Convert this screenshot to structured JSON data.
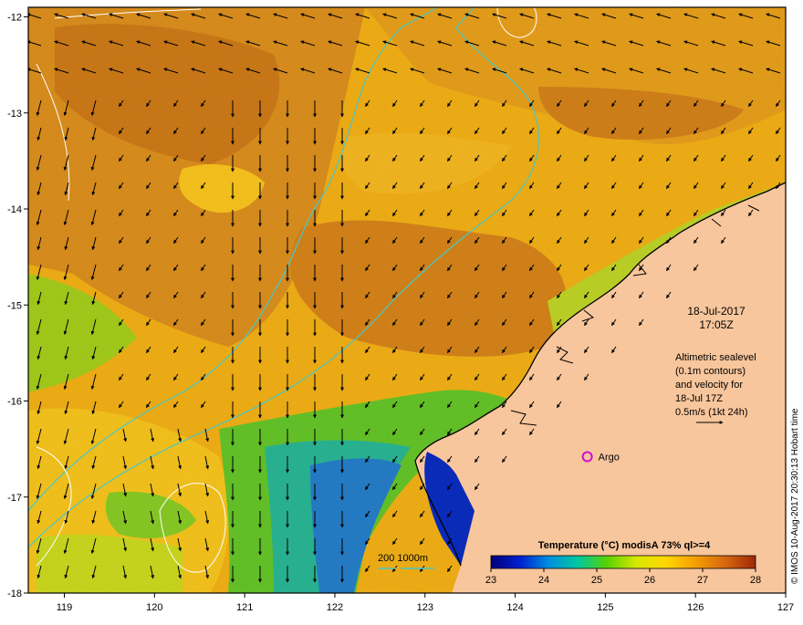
{
  "map": {
    "lon_ticks": [
      "119",
      "120",
      "121",
      "122",
      "123",
      "124",
      "125",
      "126",
      "127"
    ],
    "lat_ticks": [
      "-12",
      "-13",
      "-14",
      "-15",
      "-16",
      "-17",
      "-18"
    ],
    "lon_range": [
      118.6,
      127.0
    ],
    "lat_range": [
      -11.9,
      -18.0
    ]
  },
  "annotation": {
    "date": "18-Jul-2017",
    "time": "17:05Z",
    "altimetry_lines": [
      "Altimetric sealevel",
      "(0.1m contours)",
      "and velocity for",
      "18-Jul 17Z",
      "0.5m/s (1kt 24h)"
    ]
  },
  "argo": {
    "label": "Argo",
    "lon": 124.8,
    "lat": -16.58,
    "color": "#d010d0"
  },
  "depth_legend": {
    "label": "200  1000m",
    "color": "#46c8c8"
  },
  "colorbar": {
    "title": "Temperature (°C) modisA 73% ql>=4",
    "ticks": [
      "23",
      "24",
      "25",
      "26",
      "27",
      "28"
    ],
    "range": [
      23,
      28
    ],
    "colors": [
      "#00007a",
      "#0020d0",
      "#0090e0",
      "#00c8a0",
      "#5ad200",
      "#d8e800",
      "#ffd800",
      "#f5a000",
      "#d86a10",
      "#a02808"
    ]
  },
  "credit": "© IMOS 10-Aug-2017 20:30:13 Hobart time",
  "colors": {
    "land": "#f8c69c",
    "frame": "#000000"
  }
}
